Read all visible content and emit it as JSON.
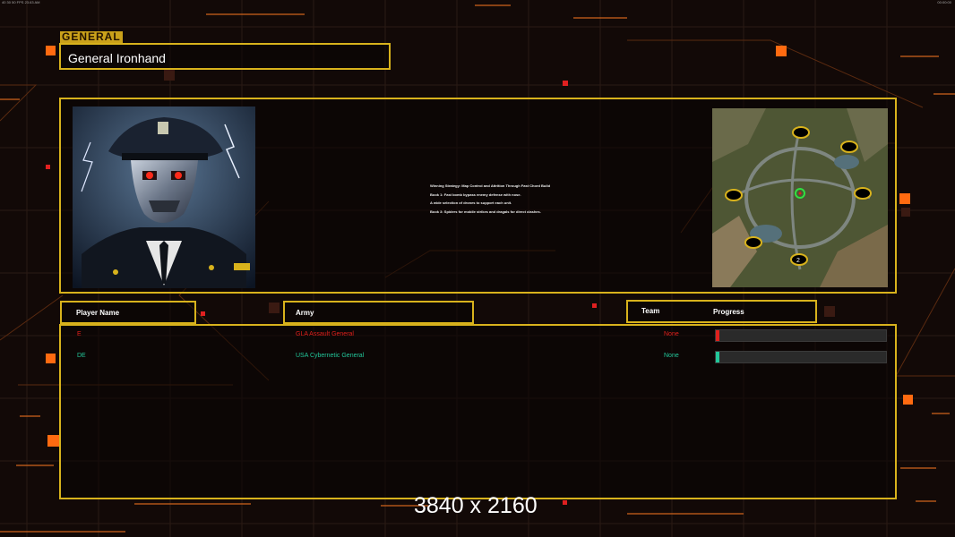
{
  "status_bar": {
    "left": "40 30 50 FPS 23.63 AM",
    "right": "00:00:00"
  },
  "header": {
    "tag": "GENERAL",
    "general_name": "General Ironhand"
  },
  "strategy": {
    "lines": [
      "Winning Strategy: Map Control and Attrition Through Fast Chord Build",
      "Book 1: Fast bomb bypass enemy defense with nose.",
      "A wide selection of drones to support each unit.",
      "Book 3: Spiders for mobile strikes and dragals for direct clashes."
    ]
  },
  "columns": {
    "player_name": "Player Name",
    "army": "Army",
    "team": "Team",
    "progress": "Progress"
  },
  "players": [
    {
      "name": "E",
      "army": "GLA Assault General",
      "team": "None",
      "progress": 0.02,
      "color": "#e0201c"
    },
    {
      "name": "DE",
      "army": "USA Cybernetic General",
      "team": "None",
      "progress": 0.02,
      "color": "#22c79a"
    }
  ],
  "footer": {
    "resolution": "3840 x 2160"
  },
  "colors": {
    "accent": "#d8b21c",
    "orange": "#ff6a10",
    "background": "#120907"
  }
}
